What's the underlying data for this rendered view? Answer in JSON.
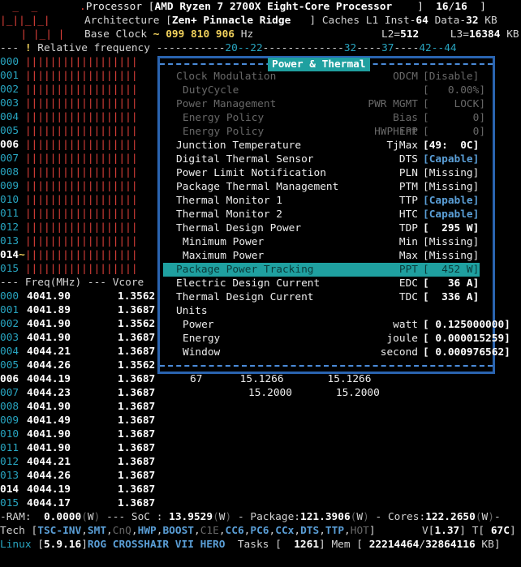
{
  "header": {
    "processor_label": "Processor",
    "processor_value": "AMD Ryzen 7 2700X Eight-Core Processor",
    "cpu_count": "16",
    "cpu_total": "16",
    "arch_label": "Architecture",
    "arch_value": "Zen+ Pinnacle Ridge",
    "caches_label": "Caches",
    "l1i_label": "L1 Inst",
    "l1i_value": "64",
    "l1d_label": "Data",
    "l1d_value": "32",
    "kb": "KB",
    "base_clock_label": "Base Clock",
    "base_clock_prefix": "~",
    "bc1": "099",
    "bc2": "810",
    "bc3": "906",
    "hz": "Hz",
    "l2_label": "L2",
    "l2_value": "512",
    "l3_label": "L3",
    "l3_value": "16384",
    "logo_lines": [
      "  _  _   ",
      "|_||_|_| ",
      "  | |_| |"
    ]
  },
  "freq_rule": {
    "label": "Relative frequency",
    "marker": "!",
    "ticks": [
      "20",
      "22",
      "32",
      "37",
      "42",
      "44"
    ]
  },
  "cores": [
    "000",
    "001",
    "002",
    "003",
    "004",
    "005",
    "006",
    "007",
    "008",
    "009",
    "010",
    "011",
    "012",
    "013",
    "014",
    "015"
  ],
  "core_list": {
    "header_freq": "Freq(MHz)",
    "header_vcore": "Vcore",
    "rows": [
      [
        "000",
        "4041.90",
        "1.3562"
      ],
      [
        "001",
        "4041.89",
        "1.3687"
      ],
      [
        "002",
        "4041.90",
        "1.3562"
      ],
      [
        "003",
        "4041.90",
        "1.3687"
      ],
      [
        "004",
        "4044.21",
        "1.3687"
      ],
      [
        "005",
        "4044.26",
        "1.3562"
      ],
      [
        "006",
        "4044.19",
        "1.3687"
      ],
      [
        "007",
        "4044.23",
        "1.3687"
      ],
      [
        "008",
        "4041.90",
        "1.3687"
      ],
      [
        "009",
        "4041.49",
        "1.3687"
      ],
      [
        "010",
        "4041.90",
        "1.3687"
      ],
      [
        "011",
        "4041.90",
        "1.3687"
      ],
      [
        "012",
        "4044.21",
        "1.3687"
      ],
      [
        "013",
        "4044.26",
        "1.3687"
      ],
      [
        "014",
        "4044.19",
        "1.3687"
      ],
      [
        "015",
        "4044.17",
        "1.3687"
      ]
    ],
    "extra_row6": [
      "67",
      "15.1266",
      "15.1266"
    ],
    "extra_row7": [
      "15.2000",
      "15.2000"
    ]
  },
  "window": {
    "title": "Power & Thermal",
    "rows": [
      {
        "k": "Clock Modulation",
        "a": "ODCM",
        "v": "[Disable]",
        "style": "dim",
        "ind": false
      },
      {
        "k": "DutyCycle",
        "a": "",
        "v": "[   0.00%]",
        "style": "dim",
        "ind": true
      },
      {
        "k": "Power Management",
        "a": "PWR MGMT",
        "v": "[    LOCK]",
        "style": "dim",
        "ind": false
      },
      {
        "k": "Energy Policy",
        "a": "Bias Hint",
        "v": "[       0]",
        "style": "dim",
        "ind": true
      },
      {
        "k": "Energy Policy",
        "a": "HWP EPP",
        "v": "[       0]",
        "style": "dim",
        "ind": true
      },
      {
        "k": "Junction Temperature",
        "a": "TjMax",
        "v": "[49:  0C]",
        "style": "normal",
        "ind": false
      },
      {
        "k": "Digital Thermal Sensor",
        "a": "DTS",
        "v": "[Capable]",
        "style": "normal",
        "ind": false
      },
      {
        "k": "Power Limit Notification",
        "a": "PLN",
        "v": "[Missing]",
        "style": "normal",
        "ind": false
      },
      {
        "k": "Package Thermal Management",
        "a": "PTM",
        "v": "[Missing]",
        "style": "normal",
        "ind": false
      },
      {
        "k": "Thermal Monitor 1",
        "a": "TTP",
        "v": "[Capable]",
        "style": "normal",
        "ind": false
      },
      {
        "k": "Thermal Monitor 2",
        "a": "HTC",
        "v": "[Capable]",
        "style": "normal",
        "ind": false
      },
      {
        "k": "Thermal Design Power",
        "a": "TDP",
        "v": "[  295 W]",
        "style": "normal",
        "ind": false
      },
      {
        "k": "Minimum Power",
        "a": "Min",
        "v": "[Missing]",
        "style": "normal",
        "ind": true
      },
      {
        "k": "Maximum Power",
        "a": "Max",
        "v": "[Missing]",
        "style": "normal",
        "ind": true
      },
      {
        "k": "Package Power Tracking",
        "a": "PPT",
        "v": "[  452 W]",
        "style": "sel",
        "ind": false
      },
      {
        "k": "Electric Design Current",
        "a": "EDC",
        "v": "[   36 A]",
        "style": "normal",
        "ind": false
      },
      {
        "k": "Thermal Design Current",
        "a": "TDC",
        "v": "[  336 A]",
        "style": "normal",
        "ind": false
      },
      {
        "k": "Units",
        "a": "",
        "v": "",
        "style": "normal",
        "ind": false
      },
      {
        "k": "Power",
        "a": "watt",
        "v": "[ 0.125000000]",
        "style": "normal",
        "ind": true
      },
      {
        "k": "Energy",
        "a": "joule",
        "v": "[ 0.000015259]",
        "style": "normal",
        "ind": true
      },
      {
        "k": "Window",
        "a": "second",
        "v": "[ 0.000976562]",
        "style": "normal",
        "ind": true
      }
    ]
  },
  "power_line": {
    "ram_label": "RAM",
    "ram": "0.0000",
    "soc_label": "SoC",
    "soc": "13.9529",
    "pkg_label": "Package",
    "pkg": "121.3906",
    "cores_label": "Cores",
    "cores": "122.2650",
    "unit": "W"
  },
  "tech_line": {
    "label": "Tech",
    "items": [
      "TSC-INV",
      "SMT",
      "CnQ",
      "HWP",
      "BOOST",
      "C1E",
      "CC6",
      "PC6",
      "CCx",
      "DTS",
      "TTP",
      "HOT"
    ],
    "v_label": "V",
    "v": "1.37",
    "t_label": "T",
    "t": "67C"
  },
  "status_line": {
    "os": "Linux",
    "kernel": "5.9.16",
    "board": "ROG CROSSHAIR VII HERO",
    "tasks_label": "Tasks",
    "tasks": "1261",
    "mem_label": "Mem",
    "mem_used": "22214464",
    "mem_total": "32864116",
    "kb": "KB"
  }
}
